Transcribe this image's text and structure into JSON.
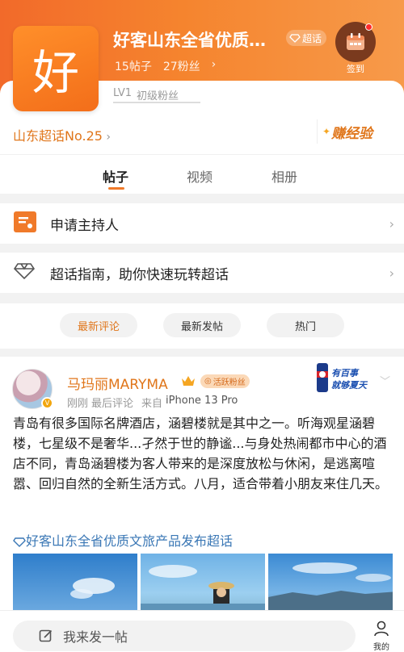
{
  "header": {
    "logo_char": "好",
    "title": "好客山东全省优质…",
    "badge": "超话",
    "posts": "15帖子",
    "fans": "27粉丝",
    "signin_label": "签到"
  },
  "level": {
    "tag": "LV1",
    "name": "初级粉丝"
  },
  "rank": "山东超话No.25",
  "earn": "赚经验",
  "tabs": [
    "帖子",
    "视频",
    "相册"
  ],
  "rows": {
    "host": "申请主持人",
    "guide": "超话指南，助你快速玩转超话"
  },
  "filters": [
    "最新评论",
    "最新发帖",
    "热门"
  ],
  "post": {
    "author": "马玛丽MARYMA",
    "fan_badge": "活跃粉丝",
    "time": "刚刚",
    "activity": "最后评论",
    "source_prefix": "来自",
    "device": "iPhone 13 Pro",
    "ad_text": "有百事 就够夏天",
    "text": "青岛有很多国际名牌酒店，涵碧楼就是其中之一。听海观星涵碧楼，七星级不是奢华...孑然于世的静谧...与身处热闹都市中心的酒店不同，青岛涵碧楼为客人带来的是深度放松与休闲，是逃离喧嚣、回归自然的全新生活方式。八月，适合带着小朋友来住几天。",
    "topic": "好客山东全省优质文旅产品发布超话"
  },
  "bottom": {
    "compose": "我来发一帖",
    "me": "我的"
  },
  "colors": {
    "accent": "#e0761b",
    "header": "#f5842e",
    "link": "#3a77b5"
  }
}
